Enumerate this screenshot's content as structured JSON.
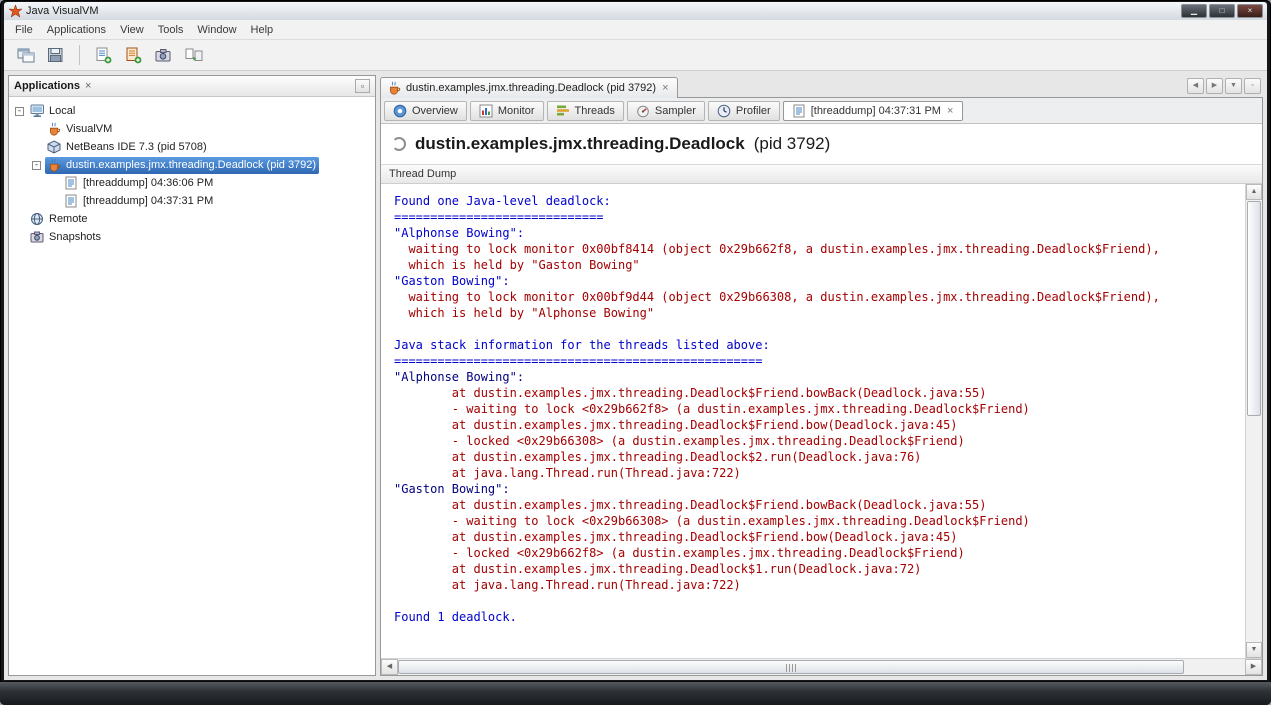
{
  "window": {
    "title": "Java VisualVM",
    "controls": [
      {
        "name": "minimize-button",
        "glyph": "▁"
      },
      {
        "name": "restore-button",
        "glyph": "□"
      },
      {
        "name": "close-button",
        "glyph": "×"
      }
    ]
  },
  "icons": {
    "close": "×",
    "float": "▫",
    "up": "▲",
    "down": "▼",
    "left": "◀",
    "right": "▶"
  },
  "menubar": {
    "items": [
      "File",
      "Applications",
      "View",
      "Tools",
      "Window",
      "Help"
    ]
  },
  "toolbar": {
    "groups": [
      [
        "open-applications-window",
        "save-view"
      ],
      [
        "add-thread-dump",
        "add-heap-dump",
        "take-snapshot",
        "compare-snapshots"
      ]
    ]
  },
  "sidebar": {
    "title": "Applications",
    "tree": [
      {
        "label": "Local",
        "level": 0,
        "expander": "minus",
        "icon": "computer-icon"
      },
      {
        "label": "VisualVM",
        "level": 1,
        "icon": "java-cup-icon"
      },
      {
        "label": "NetBeans IDE 7.3 (pid 5708)",
        "level": 1,
        "icon": "netbeans-icon"
      },
      {
        "label": "dustin.examples.jmx.threading.Deadlock (pid 3792)",
        "level": 1,
        "expander": "minus",
        "icon": "java-cup-icon",
        "selected": true
      },
      {
        "label": "[threaddump] 04:36:06 PM",
        "level": 2,
        "icon": "threaddump-icon"
      },
      {
        "label": "[threaddump] 04:37:31 PM",
        "level": 2,
        "icon": "threaddump-icon"
      },
      {
        "label": "Remote",
        "level": 0,
        "icon": "remote-icon"
      },
      {
        "label": "Snapshots",
        "level": 0,
        "icon": "snapshots-icon"
      }
    ]
  },
  "main": {
    "doc_tab": {
      "label": "dustin.examples.jmx.threading.Deadlock (pid 3792)",
      "icon": "java-cup-icon"
    },
    "tab_controls": [
      {
        "name": "scroll-tabs-left-button",
        "glyph": "◀"
      },
      {
        "name": "scroll-tabs-right-button",
        "glyph": "▶"
      },
      {
        "name": "tab-list-button",
        "glyph": "▼"
      },
      {
        "name": "float-group-button",
        "glyph": "▫"
      }
    ],
    "subtabs": [
      {
        "label": "Overview",
        "icon": "overview-icon"
      },
      {
        "label": "Monitor",
        "icon": "monitor-icon"
      },
      {
        "label": "Threads",
        "icon": "threads-icon"
      },
      {
        "label": "Sampler",
        "icon": "sampler-icon"
      },
      {
        "label": "Profiler",
        "icon": "profiler-icon"
      },
      {
        "label": "[threaddump] 04:37:31 PM",
        "icon": "threaddump-icon",
        "active": true,
        "closable": true
      }
    ],
    "heading": {
      "name": "dustin.examples.jmx.threading.Deadlock",
      "pid": " (pid 3792)"
    },
    "section_title": "Thread Dump",
    "dump_colors": {
      "blue": "#0000CC",
      "red": "#A40000",
      "navy": "#000080"
    },
    "dump_lines": [
      {
        "t": "Found one Java-level deadlock:",
        "c": "blue"
      },
      {
        "t": "=============================",
        "c": "blue"
      },
      {
        "t": "\"Alphonse Bowing\":",
        "c": "blue"
      },
      {
        "t": "  waiting to lock monitor 0x00bf8414 (object 0x29b662f8, a dustin.examples.jmx.threading.Deadlock$Friend),",
        "c": "red"
      },
      {
        "t": "  which is held by \"Gaston Bowing\"",
        "c": "red"
      },
      {
        "t": "\"Gaston Bowing\":",
        "c": "blue"
      },
      {
        "t": "  waiting to lock monitor 0x00bf9d44 (object 0x29b66308, a dustin.examples.jmx.threading.Deadlock$Friend),",
        "c": "red"
      },
      {
        "t": "  which is held by \"Alphonse Bowing\"",
        "c": "red"
      },
      {
        "t": "",
        "c": "blue"
      },
      {
        "t": "Java stack information for the threads listed above:",
        "c": "blue"
      },
      {
        "t": "===================================================",
        "c": "blue"
      },
      {
        "t": "\"Alphonse Bowing\":",
        "c": "navy"
      },
      {
        "t": "        at dustin.examples.jmx.threading.Deadlock$Friend.bowBack(Deadlock.java:55)",
        "c": "red"
      },
      {
        "t": "        - waiting to lock <0x29b662f8> (a dustin.examples.jmx.threading.Deadlock$Friend)",
        "c": "red"
      },
      {
        "t": "        at dustin.examples.jmx.threading.Deadlock$Friend.bow(Deadlock.java:45)",
        "c": "red"
      },
      {
        "t": "        - locked <0x29b66308> (a dustin.examples.jmx.threading.Deadlock$Friend)",
        "c": "red"
      },
      {
        "t": "        at dustin.examples.jmx.threading.Deadlock$2.run(Deadlock.java:76)",
        "c": "red"
      },
      {
        "t": "        at java.lang.Thread.run(Thread.java:722)",
        "c": "red"
      },
      {
        "t": "\"Gaston Bowing\":",
        "c": "navy"
      },
      {
        "t": "        at dustin.examples.jmx.threading.Deadlock$Friend.bowBack(Deadlock.java:55)",
        "c": "red"
      },
      {
        "t": "        - waiting to lock <0x29b66308> (a dustin.examples.jmx.threading.Deadlock$Friend)",
        "c": "red"
      },
      {
        "t": "        at dustin.examples.jmx.threading.Deadlock$Friend.bow(Deadlock.java:45)",
        "c": "red"
      },
      {
        "t": "        - locked <0x29b662f8> (a dustin.examples.jmx.threading.Deadlock$Friend)",
        "c": "red"
      },
      {
        "t": "        at dustin.examples.jmx.threading.Deadlock$1.run(Deadlock.java:72)",
        "c": "red"
      },
      {
        "t": "        at java.lang.Thread.run(Thread.java:722)",
        "c": "red"
      },
      {
        "t": "",
        "c": "blue"
      },
      {
        "t": "Found 1 deadlock.",
        "c": "blue"
      }
    ]
  }
}
